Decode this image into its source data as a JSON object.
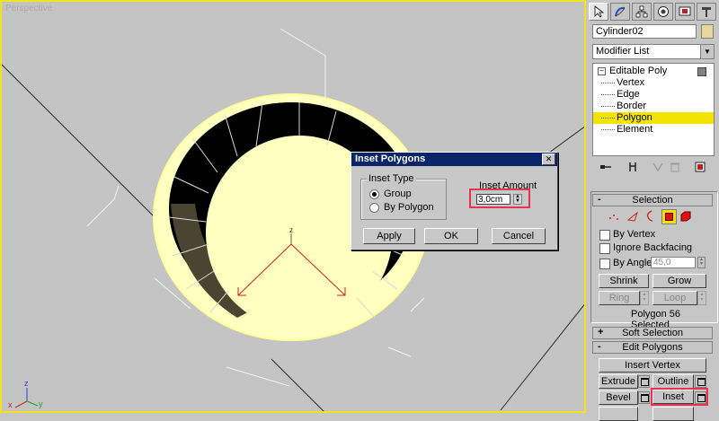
{
  "viewport": {
    "label": "Perspective"
  },
  "dialog": {
    "title": "Inset Polygons",
    "close": "✕",
    "group_title": "Inset Type",
    "options": [
      "Group",
      "By Polygon"
    ],
    "selected": "Group",
    "amount_label": "Inset Amount",
    "amount_value": "3,0cm",
    "buttons": {
      "apply": "Apply",
      "ok": "OK",
      "cancel": "Cancel"
    }
  },
  "panel": {
    "object_name": "Cylinder02",
    "modifier_list": "Modifier List",
    "stack": {
      "root": "Editable Poly",
      "subobjects": [
        "Vertex",
        "Edge",
        "Border",
        "Polygon",
        "Element"
      ],
      "selected": "Polygon"
    },
    "selection": {
      "title": "Selection",
      "by_vertex": "By Vertex",
      "ignore_backfacing": "Ignore Backfacing",
      "by_angle": "By Angle:",
      "angle_value": "45,0",
      "shrink": "Shrink",
      "grow": "Grow",
      "ring": "Ring",
      "loop": "Loop",
      "status": "Polygon 56 Selected"
    },
    "soft_selection": {
      "title": "Soft Selection",
      "sign": "+"
    },
    "edit_polygons": {
      "title": "Edit Polygons",
      "sign": "-",
      "insert_vertex": "Insert Vertex",
      "extrude": "Extrude",
      "outline": "Outline",
      "bevel": "Bevel",
      "inset": "Inset"
    },
    "selection_sign": "-",
    "colors": {
      "highlight": "#f3e400",
      "callout": "#e8324e"
    }
  },
  "axis": {
    "x": "x",
    "y": "y",
    "z": "z"
  }
}
